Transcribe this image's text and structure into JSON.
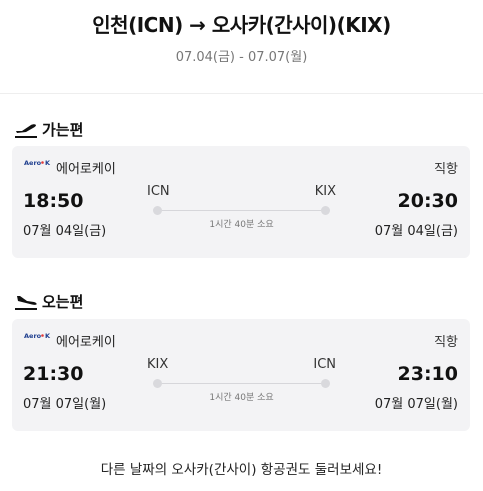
{
  "header": {
    "route_title": "인천(ICN) → 오사카(간사이)(KIX)",
    "date_range": "07.04(금) - 07.07(월)"
  },
  "outbound": {
    "section_label": "가는편",
    "airline_logo_text": "Aero K",
    "airline_name": "에어로케이",
    "flight_type": "직항",
    "departure_time": "18:50",
    "departure_date": "07월 04일(금)",
    "departure_code": "ICN",
    "arrival_time": "20:30",
    "arrival_date": "07월 04일(금)",
    "arrival_code": "KIX",
    "duration": "1시간 40분 소요"
  },
  "inbound": {
    "section_label": "오는편",
    "airline_logo_text": "Aero K",
    "airline_name": "에어로케이",
    "flight_type": "직항",
    "departure_time": "21:30",
    "departure_date": "07월 07일(월)",
    "departure_code": "KIX",
    "arrival_time": "23:10",
    "arrival_date": "07월 07일(월)",
    "arrival_code": "ICN",
    "duration": "1시간 40분 소요"
  },
  "footer": {
    "text": "다른 날짜의 오사카(간사이) 항공권도 둘러보세요!"
  },
  "colors": {
    "card_background": "#f3f3f5",
    "logo_blue": "#1f3f8f",
    "logo_accent": "#e23b3b"
  },
  "icons": {
    "outbound": "plane-takeoff-icon",
    "inbound": "plane-landing-icon"
  }
}
